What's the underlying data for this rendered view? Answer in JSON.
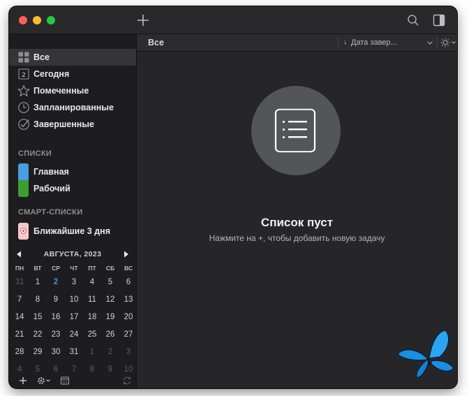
{
  "window": {
    "toolbar": {
      "add_icon": "plus-icon",
      "search_icon": "search-icon",
      "sidebar_toggle_icon": "sidebar-toggle-icon"
    }
  },
  "sidebar": {
    "nav_items": [
      {
        "label": "Все",
        "icon": "grid-icon",
        "selected": true
      },
      {
        "label": "Сегодня",
        "icon": "calendar-day-icon",
        "badge": "2"
      },
      {
        "label": "Помеченные",
        "icon": "star-icon"
      },
      {
        "label": "Запланированные",
        "icon": "clock-icon"
      },
      {
        "label": "Завершенные",
        "icon": "check-circle-icon"
      }
    ],
    "lists_title": "СПИСКИ",
    "lists": [
      {
        "label": "Главная",
        "color": "#4a9de3"
      },
      {
        "label": "Рабочий",
        "color": "#3f9e32"
      }
    ],
    "smart_lists_title": "СМАРТ-СПИСКИ",
    "smart_lists": [
      {
        "label": "Ближайшие 3 дня",
        "icon": "flower-icon",
        "color": "#f4c9c9"
      }
    ]
  },
  "calendar": {
    "month_label": "АВГУСТА, 2023",
    "weekdays": [
      "ПН",
      "ВТ",
      "СР",
      "ЧТ",
      "ПТ",
      "СБ",
      "ВС"
    ],
    "weeks": [
      [
        "31",
        "1",
        "2",
        "3",
        "4",
        "5",
        "6"
      ],
      [
        "7",
        "8",
        "9",
        "10",
        "11",
        "12",
        "13"
      ],
      [
        "14",
        "15",
        "16",
        "17",
        "18",
        "19",
        "20"
      ],
      [
        "21",
        "22",
        "23",
        "24",
        "25",
        "26",
        "27"
      ],
      [
        "28",
        "29",
        "30",
        "31",
        "1",
        "2",
        "3"
      ],
      [
        "4",
        "5",
        "6",
        "7",
        "8",
        "9",
        "10"
      ]
    ],
    "today": "2"
  },
  "content": {
    "header_title": "Все",
    "sort_label": "Дата завер...",
    "empty_title": "Список пуст",
    "empty_subtitle": "Нажмите на +, чтобы добавить новую задачу"
  },
  "colors": {
    "accent": "#3d8fe6",
    "window_bg": "#262628",
    "sidebar_bg": "#1d1d1f"
  }
}
